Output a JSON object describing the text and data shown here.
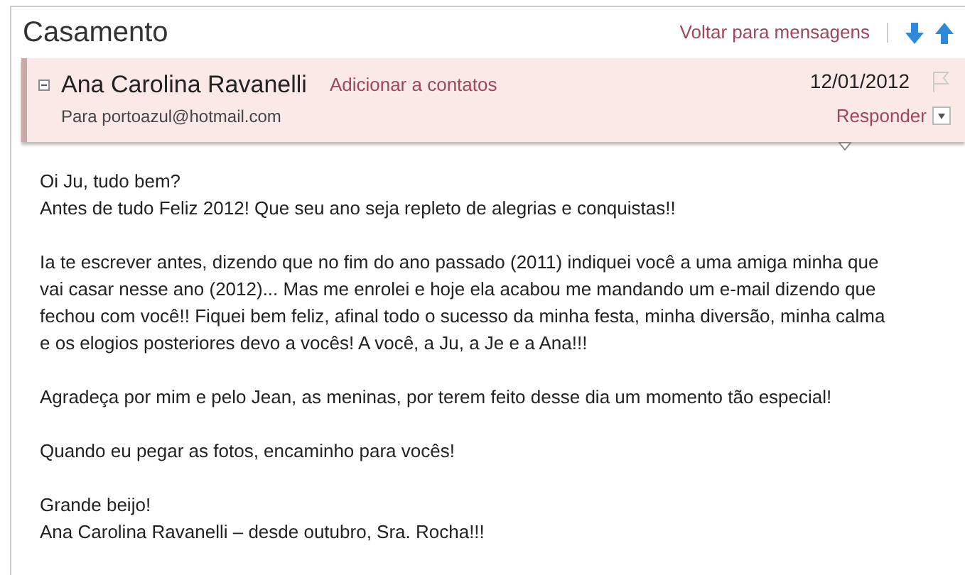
{
  "title": "Casamento",
  "back_link": "Voltar para mensagens",
  "message": {
    "sender": "Ana Carolina Ravanelli",
    "add_contact": "Adicionar a contatos",
    "to": "Para portoazul@hotmail.com",
    "date": "12/01/2012",
    "reply": "Responder",
    "flagged": false
  },
  "body": [
    [
      "Oi Ju, tudo bem?",
      "Antes de tudo Feliz 2012! Que seu ano seja repleto de alegrias e conquistas!!"
    ],
    [
      "Ia te escrever antes, dizendo que no fim do ano passado (2011) indiquei você a uma amiga minha que",
      "vai casar nesse ano (2012)... Mas me enrolei e hoje ela acabou me mandando um e-mail dizendo que",
      "fechou com você!! Fiquei bem feliz, afinal todo o sucesso da minha festa, minha diversão, minha calma",
      "e os elogios posteriores devo a vocês! A você, a Ju, a Je e a Ana!!!"
    ],
    [
      "Agradeça por mim e pelo Jean, as meninas, por terem feito desse dia um momento tão especial!"
    ],
    [
      "Quando eu pegar as fotos, encaminho para vocês!"
    ],
    [
      "Grande beijo!",
      "Ana Carolina Ravanelli – desde outubro, Sra. Rocha!!!"
    ]
  ]
}
